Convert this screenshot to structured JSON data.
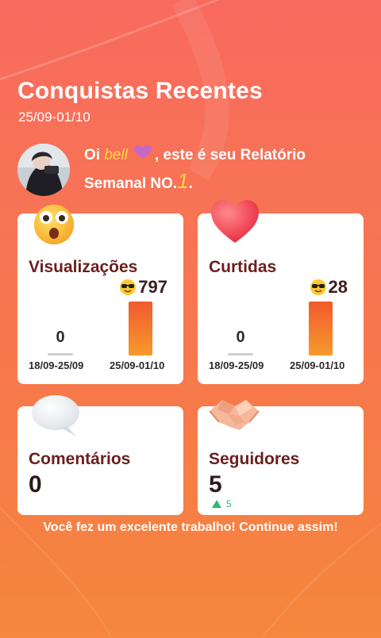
{
  "header": {
    "title": "Conquistas Recentes",
    "date_range": "25/09-01/10"
  },
  "greeting": {
    "prefix": "Oi",
    "username": "bell",
    "middle": ", este é seu Relatório",
    "line2_prefix": "Semanal NO.",
    "number": "1",
    "suffix": "."
  },
  "cards": {
    "views": {
      "label": "Visualizações",
      "current_value": "797",
      "previous_value": "0",
      "previous_range": "18/09-25/09",
      "current_range": "25/09-01/10",
      "icon": "surprised-face-icon"
    },
    "likes": {
      "label": "Curtidas",
      "current_value": "28",
      "previous_value": "0",
      "previous_range": "18/09-25/09",
      "current_range": "25/09-01/10",
      "icon": "heart-icon"
    },
    "comments": {
      "label": "Comentários",
      "value": "0",
      "icon": "speech-bubble-icon"
    },
    "followers": {
      "label": "Seguidores",
      "value": "5",
      "delta": "5",
      "icon": "handshake-icon"
    }
  },
  "footer": {
    "message": "Você fez um excelente trabalho! Continue assim!"
  },
  "colors": {
    "background_top": "#f86a5e",
    "background_bottom": "#f6873c",
    "label_text": "#6b1e1e",
    "accent_yellow": "#ffd44a",
    "bar_top": "#f15a2f",
    "bar_bottom": "#f79a2b",
    "delta_green": "#2eb872"
  }
}
